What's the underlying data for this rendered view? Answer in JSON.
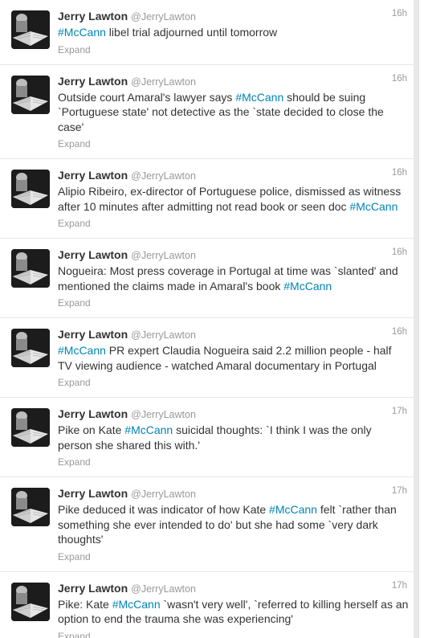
{
  "tweets": [
    {
      "name": "Jerry Lawton",
      "handle": "@JerryLawton",
      "time": "16h",
      "parts": [
        {
          "text": "#McCann",
          "hashtag": true
        },
        {
          "text": " libel trial adjourned until tomorrow"
        }
      ],
      "expand": "Expand"
    },
    {
      "name": "Jerry Lawton",
      "handle": "@JerryLawton",
      "time": "16h",
      "parts": [
        {
          "text": "Outside court Amaral's lawyer says "
        },
        {
          "text": "#McCann",
          "hashtag": true
        },
        {
          "text": " should be suing `Portuguese state' not detective as the `state decided to close the case'"
        }
      ],
      "expand": "Expand"
    },
    {
      "name": "Jerry Lawton",
      "handle": "@JerryLawton",
      "time": "16h",
      "parts": [
        {
          "text": "Alipio Ribeiro, ex-director of Portuguese police, dismissed as witness after 10 minutes after admitting not read book or seen doc "
        },
        {
          "text": "#McCann",
          "hashtag": true
        }
      ],
      "expand": "Expand"
    },
    {
      "name": "Jerry Lawton",
      "handle": "@JerryLawton",
      "time": "16h",
      "parts": [
        {
          "text": "Nogueira: Most press coverage in Portugal at time was `slanted' and mentioned the claims made in Amaral's book "
        },
        {
          "text": "#McCann",
          "hashtag": true
        }
      ],
      "expand": "Expand"
    },
    {
      "name": "Jerry Lawton",
      "handle": "@JerryLawton",
      "time": "16h",
      "parts": [
        {
          "text": "#McCann",
          "hashtag": true
        },
        {
          "text": " PR expert Claudia Nogueira said 2.2 million people - half TV viewing audience - watched Amaral documentary in Portugal"
        }
      ],
      "expand": "Expand"
    },
    {
      "name": "Jerry Lawton",
      "handle": "@JerryLawton",
      "time": "17h",
      "parts": [
        {
          "text": "Pike on Kate "
        },
        {
          "text": "#McCann",
          "hashtag": true
        },
        {
          "text": " suicidal thoughts: `I think I was the only person she shared this with.'"
        }
      ],
      "expand": "Expand"
    },
    {
      "name": "Jerry Lawton",
      "handle": "@JerryLawton",
      "time": "17h",
      "parts": [
        {
          "text": "Pike deduced it was indicator of how Kate "
        },
        {
          "text": "#McCann",
          "hashtag": true
        },
        {
          "text": " felt `rather than something she ever intended to do' but she had some `very dark thoughts'"
        }
      ],
      "expand": "Expand"
    },
    {
      "name": "Jerry Lawton",
      "handle": "@JerryLawton",
      "time": "17h",
      "parts": [
        {
          "text": "Pike: Kate "
        },
        {
          "text": "#McCann",
          "hashtag": true
        },
        {
          "text": " `wasn't very well', `referred to killing herself as an option to end the trauma she was experiencing'"
        }
      ],
      "expand": "Expand"
    }
  ]
}
